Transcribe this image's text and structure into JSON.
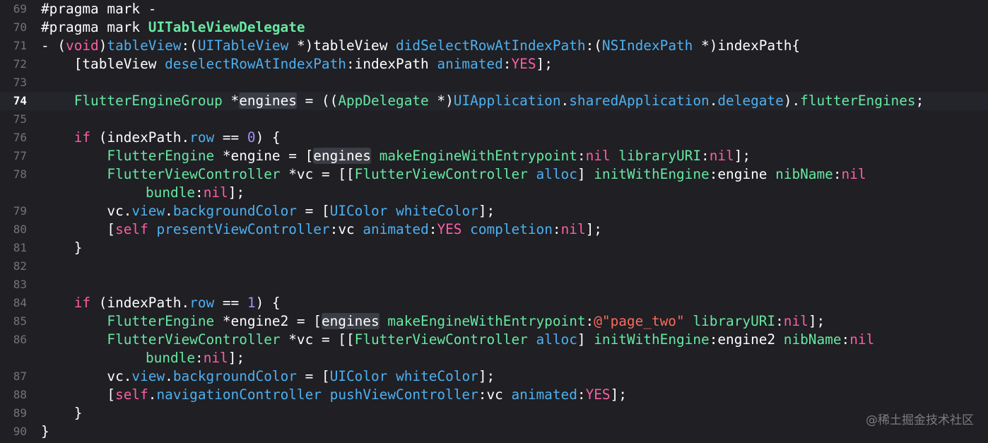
{
  "colors": {
    "plain": "#ffffff",
    "keyword": "#fc5fa3",
    "preproc": "#fd8f3f",
    "project_type": "#5dd8ff",
    "project_method": "#67b7a4",
    "sys_type": "#d0a8ff",
    "sys_method": "#41a1c0",
    "string": "#fc6a5d",
    "number": "#d0bf69",
    "mark": "#ffffff",
    "background": "#1f1f24",
    "line_number": "#747478",
    "current_line_bg": "#23252b"
  },
  "palette": {
    "kw": "#fc5fa3",
    "green": "#67e8a1",
    "blue": "#4eb0f0",
    "purple": "#a68cf6",
    "str": "#fc6a5d",
    "plain": "#ffffff",
    "mark": "#ffffff",
    "markbold": "#67e8a1"
  },
  "current_line": "74",
  "watermark": "@稀土掘金技术社区",
  "lines": [
    {
      "n": "69",
      "segs": [
        [
          "#pragma mark ",
          "mark"
        ],
        [
          "-",
          "mark"
        ]
      ]
    },
    {
      "n": "70",
      "segs": [
        [
          "#pragma mark ",
          "mark"
        ],
        [
          "UITableViewDelegate",
          "markbold"
        ]
      ]
    },
    {
      "n": "71",
      "segs": [
        [
          "- (",
          "plain"
        ],
        [
          "void",
          "kw"
        ],
        [
          ")",
          "plain"
        ],
        [
          "tableView",
          "blue"
        ],
        [
          ":(",
          "plain"
        ],
        [
          "UITableView",
          "blue"
        ],
        [
          " *)tableView ",
          "plain"
        ],
        [
          "didSelectRowAtIndexPath",
          "blue"
        ],
        [
          ":(",
          "plain"
        ],
        [
          "NSIndexPath",
          "blue"
        ],
        [
          " *)indexPath{",
          "plain"
        ]
      ]
    },
    {
      "n": "72",
      "segs": [
        [
          "    [tableView ",
          "plain"
        ],
        [
          "deselectRowAtIndexPath",
          "blue"
        ],
        [
          ":indexPath ",
          "plain"
        ],
        [
          "animated",
          "blue"
        ],
        [
          ":",
          "plain"
        ],
        [
          "YES",
          "kw"
        ],
        [
          "];",
          "plain"
        ]
      ]
    },
    {
      "n": "73",
      "segs": []
    },
    {
      "n": "74",
      "segs": [
        [
          "    ",
          "plain"
        ],
        [
          "FlutterEngineGroup",
          "green"
        ],
        [
          " *",
          "plain"
        ],
        [
          "engines",
          "plain",
          "hl"
        ],
        [
          " = ((",
          "plain"
        ],
        [
          "AppDelegate",
          "green"
        ],
        [
          " *)",
          "plain"
        ],
        [
          "UIApplication",
          "blue"
        ],
        [
          ".",
          "plain"
        ],
        [
          "sharedApplication",
          "blue"
        ],
        [
          ".",
          "plain"
        ],
        [
          "delegate",
          "blue"
        ],
        [
          ").",
          "plain"
        ],
        [
          "flutterEngines",
          "green"
        ],
        [
          ";",
          "plain"
        ]
      ]
    },
    {
      "n": "75",
      "segs": []
    },
    {
      "n": "76",
      "segs": [
        [
          "    ",
          "plain"
        ],
        [
          "if",
          "kw"
        ],
        [
          " (indexPath.",
          "plain"
        ],
        [
          "row",
          "blue"
        ],
        [
          " == ",
          "plain"
        ],
        [
          "0",
          "purple"
        ],
        [
          ") {",
          "plain"
        ]
      ]
    },
    {
      "n": "77",
      "segs": [
        [
          "        ",
          "plain"
        ],
        [
          "FlutterEngine",
          "green"
        ],
        [
          " *engine = [",
          "plain"
        ],
        [
          "engines",
          "plain",
          "hl"
        ],
        [
          " ",
          "plain"
        ],
        [
          "makeEngineWithEntrypoint",
          "green"
        ],
        [
          ":",
          "plain"
        ],
        [
          "nil",
          "kw"
        ],
        [
          " ",
          "plain"
        ],
        [
          "libraryURI",
          "green"
        ],
        [
          ":",
          "plain"
        ],
        [
          "nil",
          "kw"
        ],
        [
          "];",
          "plain"
        ]
      ]
    },
    {
      "n": "78",
      "segs": [
        [
          "        ",
          "plain"
        ],
        [
          "FlutterViewController",
          "green"
        ],
        [
          " *vc = [[",
          "plain"
        ],
        [
          "FlutterViewController",
          "green"
        ],
        [
          " ",
          "plain"
        ],
        [
          "alloc",
          "blue"
        ],
        [
          "] ",
          "plain"
        ],
        [
          "initWithEngine",
          "green"
        ],
        [
          ":engine ",
          "plain"
        ],
        [
          "nibName",
          "green"
        ],
        [
          ":",
          "plain"
        ],
        [
          "nil",
          "kw"
        ]
      ]
    },
    {
      "n": "",
      "wrap": true,
      "segs": [
        [
          "bundle",
          "green"
        ],
        [
          ":",
          "plain"
        ],
        [
          "nil",
          "kw"
        ],
        [
          "];",
          "plain"
        ]
      ]
    },
    {
      "n": "79",
      "segs": [
        [
          "        vc.",
          "plain"
        ],
        [
          "view",
          "blue"
        ],
        [
          ".",
          "plain"
        ],
        [
          "backgroundColor",
          "blue"
        ],
        [
          " = [",
          "plain"
        ],
        [
          "UIColor",
          "blue"
        ],
        [
          " ",
          "plain"
        ],
        [
          "whiteColor",
          "blue"
        ],
        [
          "];",
          "plain"
        ]
      ]
    },
    {
      "n": "80",
      "segs": [
        [
          "        [",
          "plain"
        ],
        [
          "self",
          "kw"
        ],
        [
          " ",
          "plain"
        ],
        [
          "presentViewController",
          "blue"
        ],
        [
          ":vc ",
          "plain"
        ],
        [
          "animated",
          "blue"
        ],
        [
          ":",
          "plain"
        ],
        [
          "YES",
          "kw"
        ],
        [
          " ",
          "plain"
        ],
        [
          "completion",
          "blue"
        ],
        [
          ":",
          "plain"
        ],
        [
          "nil",
          "kw"
        ],
        [
          "];",
          "plain"
        ]
      ]
    },
    {
      "n": "81",
      "segs": [
        [
          "    }",
          "plain"
        ]
      ]
    },
    {
      "n": "82",
      "segs": []
    },
    {
      "n": "83",
      "segs": []
    },
    {
      "n": "84",
      "segs": [
        [
          "    ",
          "plain"
        ],
        [
          "if",
          "kw"
        ],
        [
          " (indexPath.",
          "plain"
        ],
        [
          "row",
          "blue"
        ],
        [
          " == ",
          "plain"
        ],
        [
          "1",
          "purple"
        ],
        [
          ") {",
          "plain"
        ]
      ]
    },
    {
      "n": "85",
      "segs": [
        [
          "        ",
          "plain"
        ],
        [
          "FlutterEngine",
          "green"
        ],
        [
          " *engine2 = [",
          "plain"
        ],
        [
          "engines",
          "plain",
          "hl"
        ],
        [
          " ",
          "plain"
        ],
        [
          "makeEngineWithEntrypoint",
          "green"
        ],
        [
          ":",
          "plain"
        ],
        [
          "@\"page_two\"",
          "str"
        ],
        [
          " ",
          "plain"
        ],
        [
          "libraryURI",
          "green"
        ],
        [
          ":",
          "plain"
        ],
        [
          "nil",
          "kw"
        ],
        [
          "];",
          "plain"
        ]
      ]
    },
    {
      "n": "86",
      "segs": [
        [
          "        ",
          "plain"
        ],
        [
          "FlutterViewController",
          "green"
        ],
        [
          " *vc = [[",
          "plain"
        ],
        [
          "FlutterViewController",
          "green"
        ],
        [
          " ",
          "plain"
        ],
        [
          "alloc",
          "blue"
        ],
        [
          "] ",
          "plain"
        ],
        [
          "initWithEngine",
          "green"
        ],
        [
          ":engine2 ",
          "plain"
        ],
        [
          "nibName",
          "green"
        ],
        [
          ":",
          "plain"
        ],
        [
          "nil",
          "kw"
        ]
      ]
    },
    {
      "n": "",
      "wrap": true,
      "segs": [
        [
          "bundle",
          "green"
        ],
        [
          ":",
          "plain"
        ],
        [
          "nil",
          "kw"
        ],
        [
          "];",
          "plain"
        ]
      ]
    },
    {
      "n": "87",
      "segs": [
        [
          "        vc.",
          "plain"
        ],
        [
          "view",
          "blue"
        ],
        [
          ".",
          "plain"
        ],
        [
          "backgroundColor",
          "blue"
        ],
        [
          " = [",
          "plain"
        ],
        [
          "UIColor",
          "blue"
        ],
        [
          " ",
          "plain"
        ],
        [
          "whiteColor",
          "blue"
        ],
        [
          "];",
          "plain"
        ]
      ]
    },
    {
      "n": "88",
      "segs": [
        [
          "        [",
          "plain"
        ],
        [
          "self",
          "kw"
        ],
        [
          ".",
          "plain"
        ],
        [
          "navigationController",
          "blue"
        ],
        [
          " ",
          "plain"
        ],
        [
          "pushViewController",
          "blue"
        ],
        [
          ":vc ",
          "plain"
        ],
        [
          "animated",
          "blue"
        ],
        [
          ":",
          "plain"
        ],
        [
          "YES",
          "kw"
        ],
        [
          "];",
          "plain"
        ]
      ]
    },
    {
      "n": "89",
      "segs": [
        [
          "    }",
          "plain"
        ]
      ]
    },
    {
      "n": "90",
      "segs": [
        [
          "}",
          "plain"
        ]
      ]
    }
  ]
}
